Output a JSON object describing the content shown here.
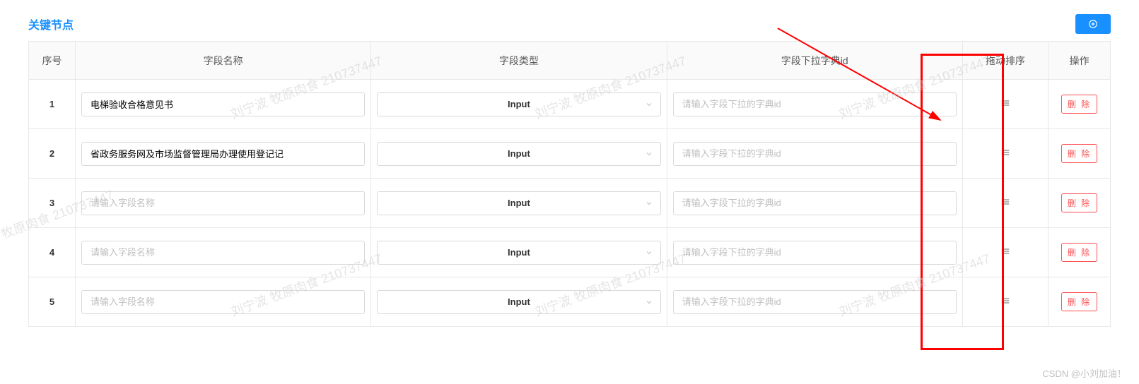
{
  "section_title": "关键节点",
  "add_button_label": "+",
  "columns": {
    "index": "序号",
    "field_name": "字段名称",
    "field_type": "字段类型",
    "dict_id": "字段下拉字典id",
    "drag_sort": "拖动排序",
    "operation": "操作"
  },
  "placeholders": {
    "field_name": "请输入字段名称",
    "dict_id": "请输入字段下拉的字典id"
  },
  "select_value": "Input",
  "delete_label": "删 除",
  "rows": [
    {
      "index": "1",
      "field_name": "电梯验收合格意见书",
      "field_type": "Input",
      "dict_id": ""
    },
    {
      "index": "2",
      "field_name": "省政务服务网及市场监督管理局办理使用登记记",
      "field_type": "Input",
      "dict_id": ""
    },
    {
      "index": "3",
      "field_name": "",
      "field_type": "Input",
      "dict_id": ""
    },
    {
      "index": "4",
      "field_name": "",
      "field_type": "Input",
      "dict_id": ""
    },
    {
      "index": "5",
      "field_name": "",
      "field_type": "Input",
      "dict_id": ""
    }
  ],
  "watermark_text": "刘宁波 牧原肉食 210737447",
  "footer_watermark": "CSDN @小刘加油！"
}
